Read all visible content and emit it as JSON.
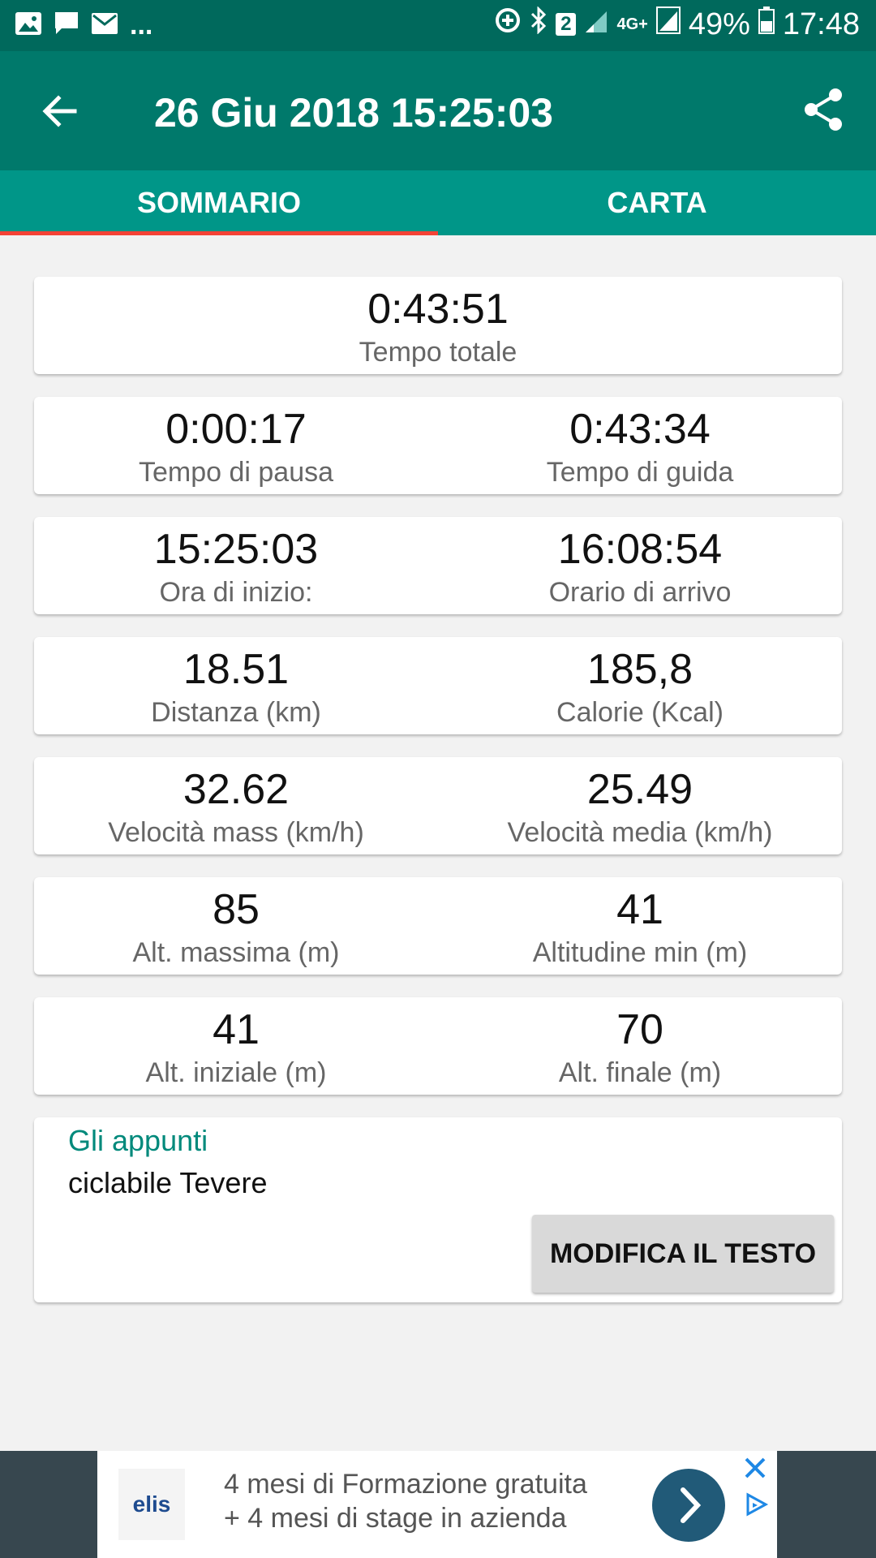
{
  "status_bar": {
    "more": "...",
    "sim_slot": "2",
    "network": "4G+",
    "battery": "49%",
    "time": "17:48"
  },
  "header": {
    "title": "26 Giu 2018 15:25:03"
  },
  "tabs": [
    {
      "label": "SOMMARIO",
      "active": true
    },
    {
      "label": "CARTA",
      "active": false
    }
  ],
  "summary": {
    "total": {
      "value": "0:43:51",
      "label": "Tempo totale"
    },
    "rows": [
      {
        "left": {
          "value": "0:00:17",
          "label": "Tempo di pausa"
        },
        "right": {
          "value": "0:43:34",
          "label": "Tempo di guida"
        }
      },
      {
        "left": {
          "value": "15:25:03",
          "label": "Ora di inizio:"
        },
        "right": {
          "value": "16:08:54",
          "label": "Orario di arrivo"
        }
      },
      {
        "left": {
          "value": "18.51",
          "label": "Distanza (km)"
        },
        "right": {
          "value": "185,8",
          "label": "Calorie (Kcal)"
        }
      },
      {
        "left": {
          "value": "32.62",
          "label": "Velocità mass (km/h)"
        },
        "right": {
          "value": "25.49",
          "label": "Velocità media (km/h)"
        }
      },
      {
        "left": {
          "value": "85",
          "label": "Alt. massima (m)"
        },
        "right": {
          "value": "41",
          "label": "Altitudine min (m)"
        }
      },
      {
        "left": {
          "value": "41",
          "label": "Alt. iniziale (m)"
        },
        "right": {
          "value": "70",
          "label": "Alt. finale (m)"
        }
      }
    ]
  },
  "notes": {
    "title": "Gli appunti",
    "text": "ciclabile Tevere",
    "edit_button": "MODIFICA IL TESTO"
  },
  "ad": {
    "logo": "elis",
    "line1": "4 mesi di Formazione gratuita",
    "line2": "+ 4 mesi di stage in azienda"
  },
  "colors": {
    "status_bar": "#00695c",
    "app_bar": "#00796b",
    "tabs": "#009688",
    "tab_indicator": "#f44336",
    "notes_title": "#00897b"
  }
}
